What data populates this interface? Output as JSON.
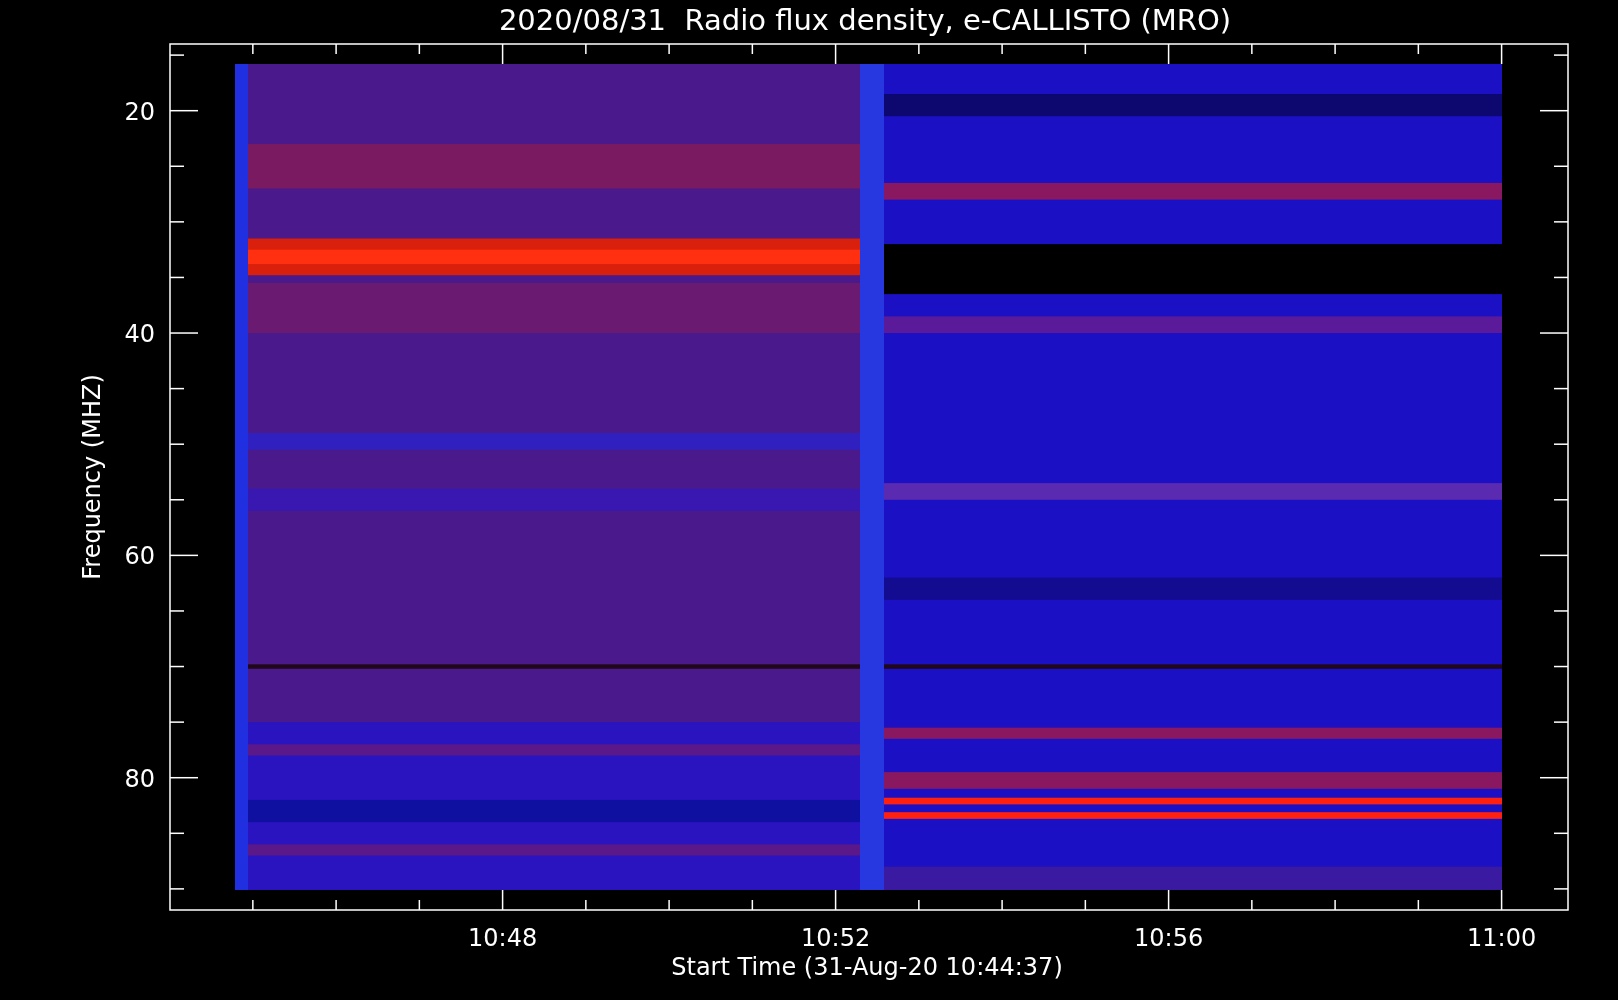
{
  "title": "2020/08/31  Radio flux density, e-CALLISTO (MRO)",
  "y_axis": {
    "label": "Frequency (MHZ)",
    "ticks": [
      "20",
      "40",
      "60",
      "80"
    ]
  },
  "x_axis": {
    "label": "Start Time (31-Aug-20 10:44:37)",
    "ticks": [
      "10:48",
      "10:52",
      "10:56",
      "11:00"
    ]
  }
}
